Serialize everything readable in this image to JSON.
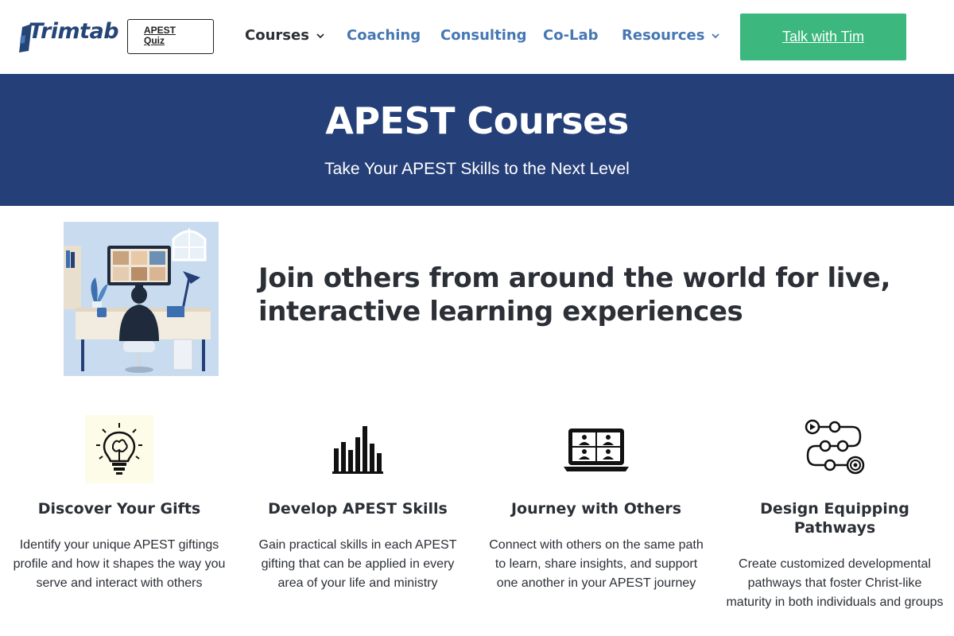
{
  "header": {
    "logo_text": "Trimtab",
    "quiz_button": {
      "line1": "APEST",
      "line2": "Quiz"
    },
    "nav": [
      {
        "label": "Courses",
        "has_dropdown": true
      },
      {
        "label": "Coaching",
        "has_dropdown": false
      },
      {
        "label": "Consulting",
        "has_dropdown": false
      },
      {
        "label": "Co-Lab",
        "has_dropdown": false
      },
      {
        "label": "Resources",
        "has_dropdown": true
      }
    ],
    "cta_label": "Talk with Tim"
  },
  "hero": {
    "title": "APEST Courses",
    "subtitle": "Take Your APEST Skills to the Next Level"
  },
  "intro": {
    "heading": "Join others from around the world for live, interactive learning experiences",
    "image_icon": "online-meeting-illustration"
  },
  "cards": [
    {
      "icon": "lightbulb-brain-icon",
      "title": "Discover Your Gifts",
      "text": "Identify your unique APEST giftings profile and how it shapes the way you serve and interact with others"
    },
    {
      "icon": "bar-chart-icon",
      "title": "Develop APEST Skills",
      "text": "Gain practical skills in each APEST gifting that can be applied in every area of your life and ministry"
    },
    {
      "icon": "video-conference-laptop-icon",
      "title": "Journey with Others",
      "text": "Connect with others on the same path to learn, share insights, and support one another in your APEST journey"
    },
    {
      "icon": "pathway-target-icon",
      "title": "Design Equipping Pathways",
      "text": "Create customized developmental pathways that foster Christ-like maturity in both individuals and groups"
    }
  ],
  "colors": {
    "brand_navy": "#253f78",
    "nav_blue": "#4677b3",
    "cta_green": "#3cb77d",
    "text_dark": "#2b2f36"
  }
}
